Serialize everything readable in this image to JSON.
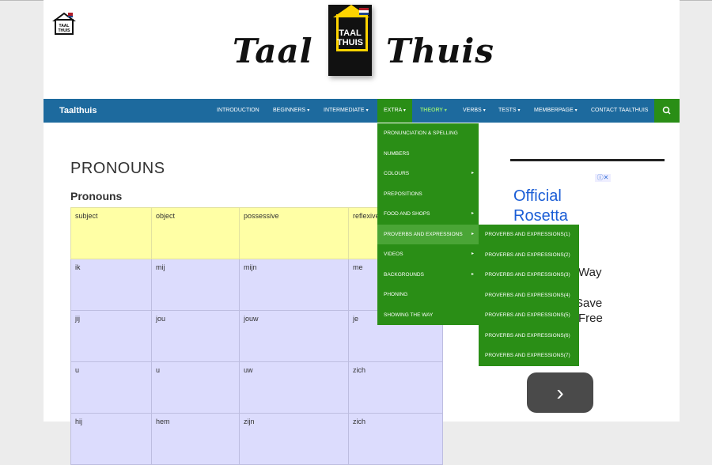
{
  "header": {
    "small_logo_text": "TAAL THUIS",
    "title_left": "Taal",
    "title_right": "Thuis",
    "book_text_1": "TAAL",
    "book_text_2": "THUIS"
  },
  "nav": {
    "brand": "Taalthuis",
    "items": [
      {
        "label": "INTRODUCTION",
        "caret": ""
      },
      {
        "label": "BEGINNERS",
        "caret": "▾"
      },
      {
        "label": "INTERMEDIATE",
        "caret": "▾"
      },
      {
        "label": "EXTRA",
        "caret": "▾"
      },
      {
        "label": "THEORY",
        "caret": "▾"
      },
      {
        "label": "VERBS",
        "caret": "▾"
      },
      {
        "label": "TESTS",
        "caret": "▾"
      },
      {
        "label": "MEMBERPAGE",
        "caret": "▾"
      },
      {
        "label": "CONTACT TAALTHUIS",
        "caret": ""
      }
    ],
    "search_icon": "search-icon"
  },
  "theory_menu": [
    {
      "label": "PRONUNCIATION & SPELLING",
      "arrow": ""
    },
    {
      "label": "NUMBERS",
      "arrow": ""
    },
    {
      "label": "COLOURS",
      "arrow": "▸"
    },
    {
      "label": "PREPOSITIONS",
      "arrow": ""
    },
    {
      "label": "FOOD AND SHOPS",
      "arrow": "▸"
    },
    {
      "label": "PROVERBS AND EXPRESSIONS",
      "arrow": "▸"
    },
    {
      "label": "VIDEOS",
      "arrow": "▸"
    },
    {
      "label": "BACKGROUNDS",
      "arrow": "▸"
    },
    {
      "label": "PHONING",
      "arrow": ""
    },
    {
      "label": "SHOWING THE WAY",
      "arrow": ""
    }
  ],
  "proverbs_menu": [
    "PROVERBS AND EXPRESSIONS(1)",
    "PROVERBS AND EXPRESSIONS(2)",
    "PROVERBS AND EXPRESSIONS(3)",
    "PROVERBS AND EXPRESSIONS(4)",
    "PROVERBS AND EXPRESSIONS(5)",
    "PROVERBS AND EXPRESSIONS(6)",
    "PROVERBS AND EXPRESSIONS(7)"
  ],
  "main": {
    "page_title": "PRONOUNS",
    "section_title": "Pronouns",
    "table": {
      "headers": [
        "subject",
        "object",
        "possessive",
        "reflexive"
      ],
      "rows": [
        [
          "ik",
          "mij",
          "mijn",
          "me"
        ],
        [
          "jij",
          "jou",
          "jouw",
          "je"
        ],
        [
          "u",
          "u",
          "uw",
          "zich"
        ],
        [
          "hij",
          "hem",
          "zijn",
          "zich"
        ]
      ]
    }
  },
  "ad": {
    "line1": "Official",
    "line2": "Rosetta",
    "line3": "Way",
    "line4": "Save",
    "line5": "Free",
    "next_icon": "chevron-right-icon"
  }
}
